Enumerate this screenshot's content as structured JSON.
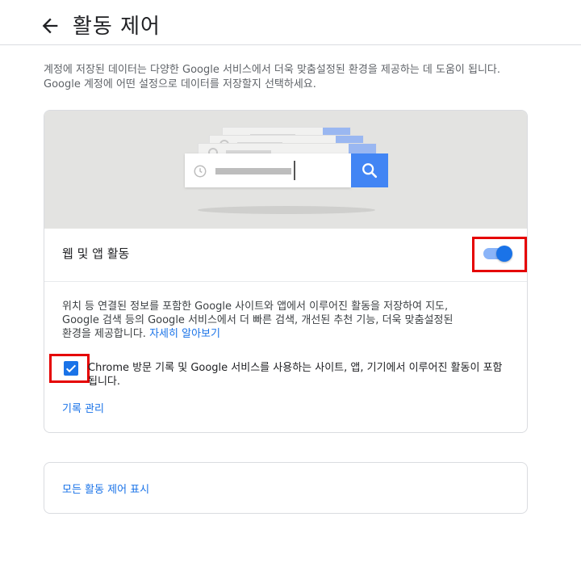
{
  "header": {
    "title": "활동 제어",
    "back_icon": "arrow-back-icon"
  },
  "intro_text": "계정에 저장된 데이터는 다양한 Google 서비스에서 더욱 맞춤설정된 환경을 제공하는 데 도움이 됩니다. Google 계정에 어떤 설정으로 데이터를 저장할지 선택하세요.",
  "web_app_activity": {
    "label": "웹 및 앱 활동",
    "toggle_on": true,
    "description": "위치 등 연결된 정보를 포함한 Google 사이트와 앱에서 이루어진 활동을 저장하여 지도, Google 검색 등의 Google 서비스에서 더 빠른 검색, 개선된 추천 기능, 더욱 맞춤설정된 환경을 제공합니다.",
    "learn_more": "자세히 알아보기",
    "checkbox_checked": true,
    "checkbox_label": "Chrome 방문 기록 및 Google 서비스를 사용하는 사이트, 앱, 기기에서 이루어진 활동이 포함됩니다.",
    "manage_link": "기록 관리"
  },
  "all_controls_link": "모든 활동 제어 표시",
  "colors": {
    "accent": "#1a73e8",
    "highlight_box": "#e50000",
    "hero_bg": "#e3e3e1",
    "search_blue": "#4285f4"
  }
}
